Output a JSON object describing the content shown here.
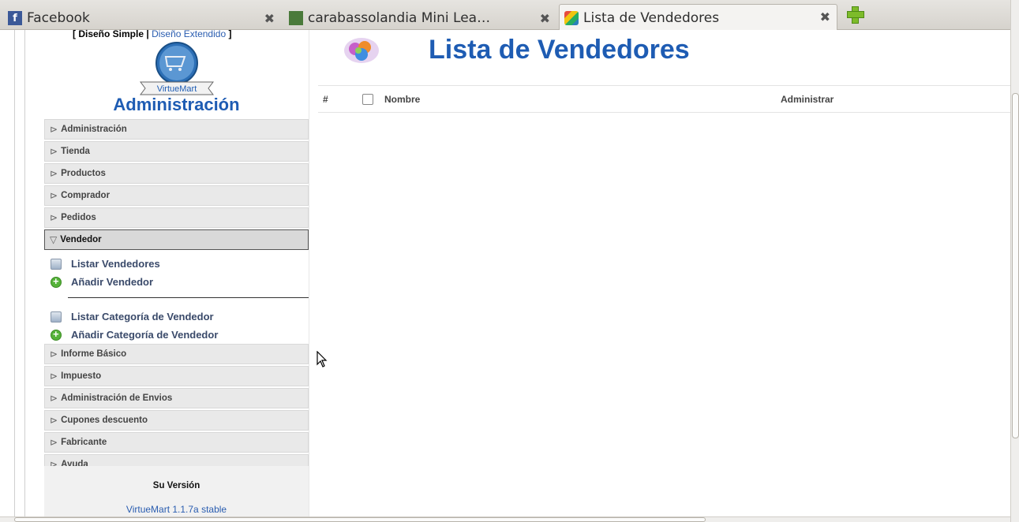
{
  "browser": {
    "tabs": [
      {
        "label": "Facebook",
        "icon": "facebook-icon",
        "active": false
      },
      {
        "label": "carabassolandia Mini Lea…",
        "icon": "site-icon",
        "active": false
      },
      {
        "label": "Lista de Vendedores",
        "icon": "joomla-icon",
        "active": true
      }
    ],
    "new_tab_icon": "plus-icon"
  },
  "sidebar": {
    "design_simple": "[ Diseño Simple |",
    "design_extended": "Diseño Extendido",
    "design_close": " ]",
    "logo_text": "VirtueMart",
    "title": "Administración",
    "menu": [
      {
        "label": "Administración"
      },
      {
        "label": "Tienda"
      },
      {
        "label": "Productos"
      },
      {
        "label": "Comprador"
      },
      {
        "label": "Pedidos"
      },
      {
        "label": "Vendedor"
      }
    ],
    "submenu": [
      {
        "label": "Listar Vendedores",
        "icon": "list-icon"
      },
      {
        "label": "Añadir Vendedor",
        "icon": "add-icon"
      },
      {
        "label": "Listar Categoría de Vendedor",
        "icon": "list-icon"
      },
      {
        "label": "Añadir Categoría de Vendedor",
        "icon": "add-icon"
      }
    ],
    "menu_after": [
      {
        "label": "Informe Básico"
      },
      {
        "label": "Impuesto"
      },
      {
        "label": "Administración de Envios"
      },
      {
        "label": "Cupones descuento"
      },
      {
        "label": "Fabricante"
      },
      {
        "label": "Ayuda"
      }
    ],
    "version_label": "Su Versión",
    "version_value": "VirtueMart 1.1.7a stable"
  },
  "main": {
    "title": "Lista de Vendedores",
    "table": {
      "headers": [
        "#",
        "Nombre",
        "Administrar"
      ]
    }
  },
  "colors": {
    "accent": "#1e5cb3",
    "link": "#2a5db0"
  }
}
